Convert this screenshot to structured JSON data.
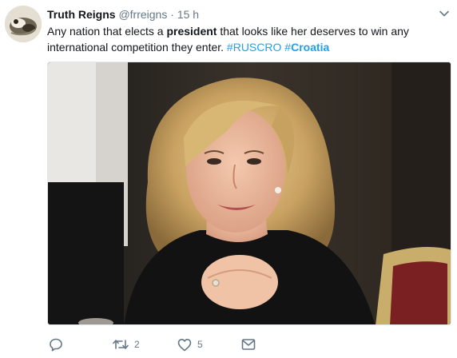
{
  "tweet": {
    "display_name": "Truth Reigns",
    "handle": "@frreigns",
    "separator": "·",
    "timestamp": "15 h",
    "text_part1": "Any nation that elects a ",
    "text_bold": "president",
    "text_part2": " that looks like her deserves to win any international competition they enter. ",
    "hashtag1": "#RUSCRO",
    "hashtag2_hash": "#",
    "hashtag2_word": "Croatia",
    "image_description": "photo"
  },
  "actions": {
    "reply_icon": "reply-icon",
    "retweet_icon": "retweet-icon",
    "retweet_count": "2",
    "like_icon": "heart-icon",
    "like_count": "5",
    "dm_icon": "envelope-icon"
  },
  "colors": {
    "link": "#1da1f2",
    "secondary_text": "#657786",
    "primary_text": "#14171a"
  }
}
